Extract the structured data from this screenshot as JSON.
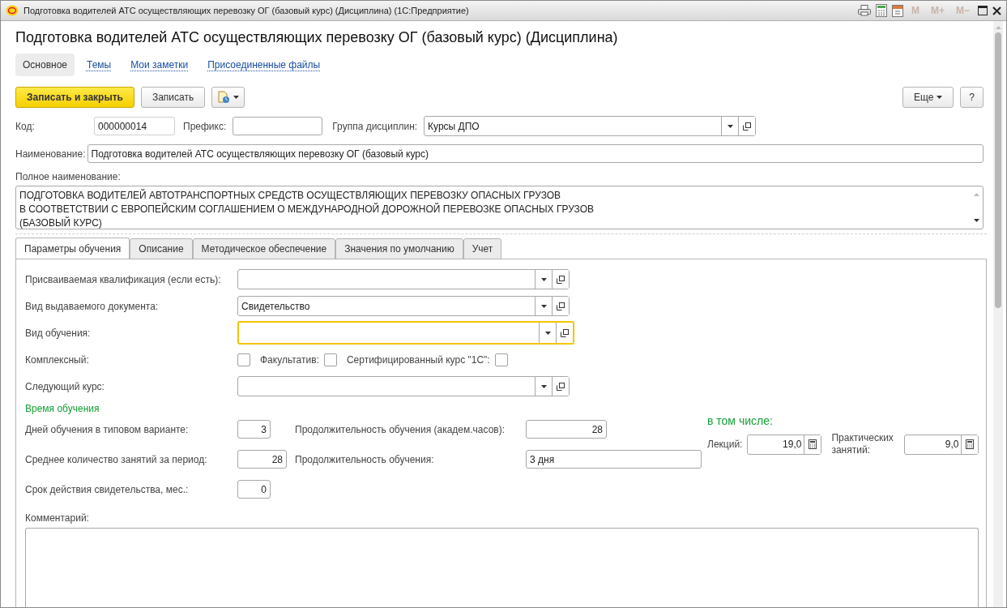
{
  "window": {
    "title": "Подготовка водителей АТС осуществляющих перевозку ОГ (базовый курс) (Дисциплина)  (1С:Предприятие)"
  },
  "memory_buttons": [
    {
      "label": "M",
      "disabled": true
    },
    {
      "label": "M+",
      "disabled": true
    },
    {
      "label": "M−",
      "disabled": true
    }
  ],
  "form_title": "Подготовка водителей АТС осуществляющих перевозку ОГ (базовый курс) (Дисциплина)",
  "nav": [
    {
      "label": "Основное",
      "selected": true
    },
    {
      "label": "Темы",
      "selected": false
    },
    {
      "label": "Мои заметки",
      "selected": false
    },
    {
      "label": "Присоединенные файлы",
      "selected": false
    }
  ],
  "toolbar": {
    "save_close": "Записать и закрыть",
    "save": "Записать",
    "more": "Еще",
    "help": "?"
  },
  "code": {
    "label": "Код:",
    "value": "000000014"
  },
  "prefix": {
    "label": "Префикс:"
  },
  "group": {
    "label": "Группа дисциплин:",
    "value": "Курсы ДПО"
  },
  "name": {
    "label": "Наименование:",
    "value": "Подготовка водителей АТС осуществляющих перевозку ОГ (базовый курс)"
  },
  "full_name": {
    "label": "Полное наименование:",
    "lines": [
      "ПОДГОТОВКА ВОДИТЕЛЕЙ АВТОТРАНСПОРТНЫХ СРЕДСТВ ОСУЩЕСТВЛЯЮЩИХ ПЕРЕВОЗКУ ОПАСНЫХ ГРУЗОВ",
      "В СООТВЕТСТВИИ С ЕВРОПЕЙСКИМ СОГЛАШЕНИЕМ О МЕЖДУНАРОДНОЙ ДОРОЖНОЙ ПЕРЕВОЗКЕ ОПАСНЫХ ГРУЗОВ",
      "(БАЗОВЫЙ КУРС)"
    ]
  },
  "tabs": [
    {
      "label": "Параметры обучения",
      "selected": true
    },
    {
      "label": "Описание",
      "selected": false
    },
    {
      "label": "Методическое обеспечение",
      "selected": false
    },
    {
      "label": "Значения по умолчанию",
      "selected": false
    },
    {
      "label": "Учет",
      "selected": false
    }
  ],
  "params": [
    {
      "kind": "combo",
      "label": "Присваиваемая квалификация (если есть):",
      "focused": false
    },
    {
      "kind": "combo",
      "label": "Вид выдаваемого документа:",
      "value": "Свидетельство",
      "focused": false
    },
    {
      "kind": "combo",
      "label": "Вид обучения:",
      "focused": true
    },
    {
      "kind": "checks",
      "label": "Комплексный:",
      "checked": false,
      "extra": [
        {
          "label": "Факультатив:",
          "checked": false
        },
        {
          "label": "Сертифицированный курс \"1С\":",
          "checked": false
        }
      ]
    },
    {
      "kind": "combo",
      "label": "Следующий курс:",
      "focused": false
    }
  ],
  "time": {
    "heading": "Время обучения",
    "days": {
      "label": "Дней обучения в типовом варианте:",
      "value": "3"
    },
    "lessons": {
      "label": "Среднее количество занятий за период:",
      "value": "28"
    },
    "validity": {
      "label": "Срок действия свидетельства, мес.:",
      "value": "0"
    },
    "hours": {
      "label": "Продолжительность обучения (академ.часов):",
      "value": "28"
    },
    "duration": {
      "label": "Продолжительность обучения:",
      "value": "3 дня"
    },
    "including": "в том числе:",
    "lectures": {
      "label": "Лекций:",
      "value": "19,0"
    },
    "practice": {
      "label": "Практических занятий:",
      "value": "9,0"
    }
  },
  "comment": {
    "label": "Комментарий:"
  }
}
